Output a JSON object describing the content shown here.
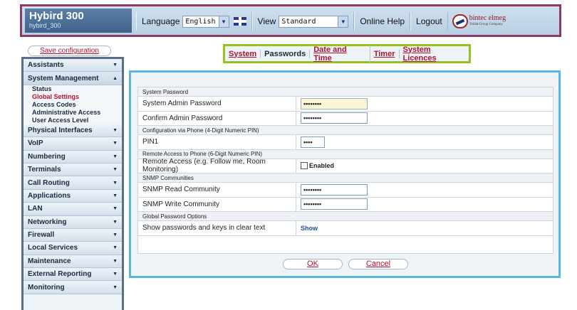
{
  "header": {
    "brand_title": "Hybird 300",
    "brand_sub": "hybird_300",
    "language_label": "Language",
    "language_value": "English",
    "view_label": "View",
    "view_value": "Standard",
    "online_help": "Online Help",
    "logout": "Logout",
    "logo_text": "bintec elmeg",
    "logo_small": "Teldat Group Company"
  },
  "sidebar": {
    "save_label": "Save configuration",
    "items": [
      {
        "label": "Assistants",
        "open": false
      },
      {
        "label": "System Management",
        "open": true,
        "children": [
          {
            "label": "Status",
            "active": false
          },
          {
            "label": "Global Settings",
            "active": true
          },
          {
            "label": "Access Codes",
            "active": false
          },
          {
            "label": "Administrative Access",
            "active": false
          },
          {
            "label": "User Access Level",
            "active": false
          }
        ]
      },
      {
        "label": "Physical Interfaces",
        "open": false
      },
      {
        "label": "VoIP",
        "open": false
      },
      {
        "label": "Numbering",
        "open": false
      },
      {
        "label": "Terminals",
        "open": false
      },
      {
        "label": "Call Routing",
        "open": false
      },
      {
        "label": "Applications",
        "open": false
      },
      {
        "label": "LAN",
        "open": false
      },
      {
        "label": "Networking",
        "open": false
      },
      {
        "label": "Firewall",
        "open": false
      },
      {
        "label": "Local Services",
        "open": false
      },
      {
        "label": "Maintenance",
        "open": false
      },
      {
        "label": "External Reporting",
        "open": false
      },
      {
        "label": "Monitoring",
        "open": false
      }
    ]
  },
  "tabs": [
    {
      "label": "System",
      "active": false
    },
    {
      "label": "Passwords",
      "active": true
    },
    {
      "label": "Date and Time",
      "active": false
    },
    {
      "label": "Timer",
      "active": false
    },
    {
      "label": "System Licences",
      "active": false
    }
  ],
  "form": {
    "rows": [
      {
        "type": "section",
        "label": "System Password"
      },
      {
        "type": "field",
        "label": "System Admin Password",
        "value": "••••••••",
        "width": 94,
        "focused": true
      },
      {
        "type": "field",
        "label": "Confirm Admin Password",
        "value": "••••••••",
        "width": 94
      },
      {
        "type": "section",
        "label": "Configuration via Phone (4-Digit Numeric PIN)"
      },
      {
        "type": "field",
        "label": "PIN1",
        "value": "••••",
        "width": 34
      },
      {
        "type": "section",
        "label": "Remote Access to Phone (6-Digit Numeric PIN)"
      },
      {
        "type": "check",
        "label": "Remote Access (e.g. Follow me, Room Monitoring)",
        "value": "Enabled"
      },
      {
        "type": "section",
        "label": "SNMP Communities"
      },
      {
        "type": "field",
        "label": "SNMP Read Community",
        "value": "••••••••",
        "width": 94
      },
      {
        "type": "field",
        "label": "SNMP Write Community",
        "value": "••••••••",
        "width": 94
      },
      {
        "type": "section",
        "label": "Global Password Options"
      },
      {
        "type": "link",
        "label": "Show passwords and keys in clear text",
        "value": "Show"
      }
    ],
    "ok_label": "OK",
    "cancel_label": "Cancel"
  }
}
